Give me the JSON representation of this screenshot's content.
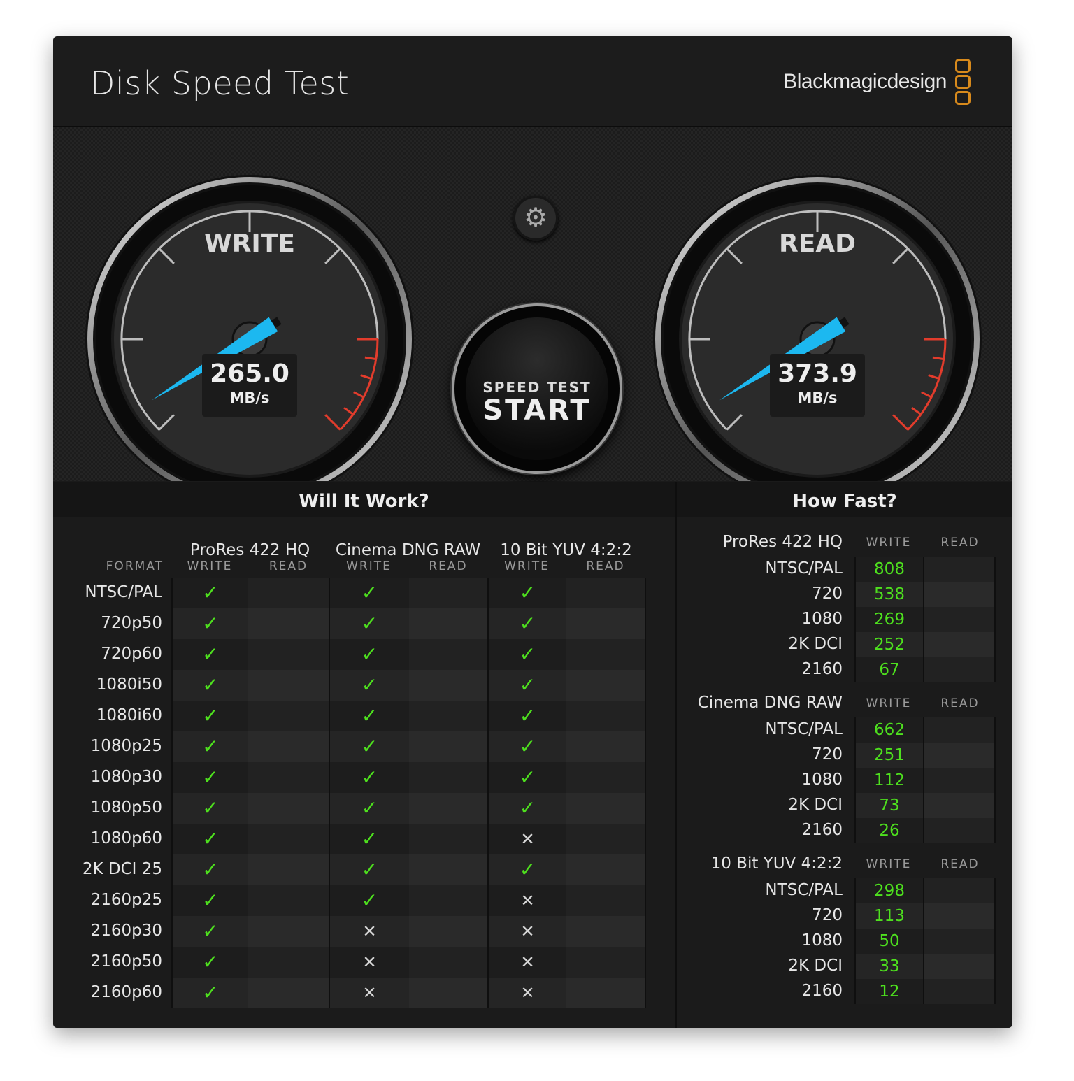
{
  "window": {
    "title": "Disk Speed Test",
    "brand": "Blackmagicdesign",
    "close_icon": "close-icon"
  },
  "colors": {
    "accent_needle": "#1cb8f0",
    "redline": "#e23c2c",
    "ok": "#4ee01e",
    "brand_logo": "#d88a1c"
  },
  "gauges": {
    "write": {
      "label": "WRITE",
      "value": "265.0",
      "unit": "MB/s"
    },
    "read": {
      "label": "READ",
      "value": "373.9",
      "unit": "MB/s"
    }
  },
  "controls": {
    "settings_icon": "gear-icon",
    "start_line1": "SPEED TEST",
    "start_line2": "START"
  },
  "will_it_work": {
    "title": "Will It Work?",
    "format_header": "FORMAT",
    "write_label": "WRITE",
    "read_label": "READ",
    "codecs": [
      "ProRes 422 HQ",
      "Cinema DNG RAW",
      "10 Bit YUV 4:2:2"
    ],
    "rows": [
      {
        "format": "NTSC/PAL",
        "write": [
          "yes",
          "yes",
          "yes"
        ]
      },
      {
        "format": "720p50",
        "write": [
          "yes",
          "yes",
          "yes"
        ]
      },
      {
        "format": "720p60",
        "write": [
          "yes",
          "yes",
          "yes"
        ]
      },
      {
        "format": "1080i50",
        "write": [
          "yes",
          "yes",
          "yes"
        ]
      },
      {
        "format": "1080i60",
        "write": [
          "yes",
          "yes",
          "yes"
        ]
      },
      {
        "format": "1080p25",
        "write": [
          "yes",
          "yes",
          "yes"
        ]
      },
      {
        "format": "1080p30",
        "write": [
          "yes",
          "yes",
          "yes"
        ]
      },
      {
        "format": "1080p50",
        "write": [
          "yes",
          "yes",
          "yes"
        ]
      },
      {
        "format": "1080p60",
        "write": [
          "yes",
          "yes",
          "no"
        ]
      },
      {
        "format": "2K DCI 25",
        "write": [
          "yes",
          "yes",
          "yes"
        ]
      },
      {
        "format": "2160p25",
        "write": [
          "yes",
          "yes",
          "no"
        ]
      },
      {
        "format": "2160p30",
        "write": [
          "yes",
          "no",
          "no"
        ]
      },
      {
        "format": "2160p50",
        "write": [
          "yes",
          "no",
          "no"
        ]
      },
      {
        "format": "2160p60",
        "write": [
          "yes",
          "no",
          "no"
        ]
      }
    ],
    "yes_glyph": "✓",
    "no_glyph": "✕"
  },
  "how_fast": {
    "title": "How Fast?",
    "write_label": "WRITE",
    "read_label": "READ",
    "groups": [
      {
        "codec": "ProRes 422 HQ",
        "rows": [
          {
            "format": "NTSC/PAL",
            "write": "808"
          },
          {
            "format": "720",
            "write": "538"
          },
          {
            "format": "1080",
            "write": "269"
          },
          {
            "format": "2K DCI",
            "write": "252"
          },
          {
            "format": "2160",
            "write": "67"
          }
        ]
      },
      {
        "codec": "Cinema DNG RAW",
        "rows": [
          {
            "format": "NTSC/PAL",
            "write": "662"
          },
          {
            "format": "720",
            "write": "251"
          },
          {
            "format": "1080",
            "write": "112"
          },
          {
            "format": "2K DCI",
            "write": "73"
          },
          {
            "format": "2160",
            "write": "26"
          }
        ]
      },
      {
        "codec": "10 Bit YUV 4:2:2",
        "rows": [
          {
            "format": "NTSC/PAL",
            "write": "298"
          },
          {
            "format": "720",
            "write": "113"
          },
          {
            "format": "1080",
            "write": "50"
          },
          {
            "format": "2K DCI",
            "write": "33"
          },
          {
            "format": "2160",
            "write": "12"
          }
        ]
      }
    ]
  }
}
